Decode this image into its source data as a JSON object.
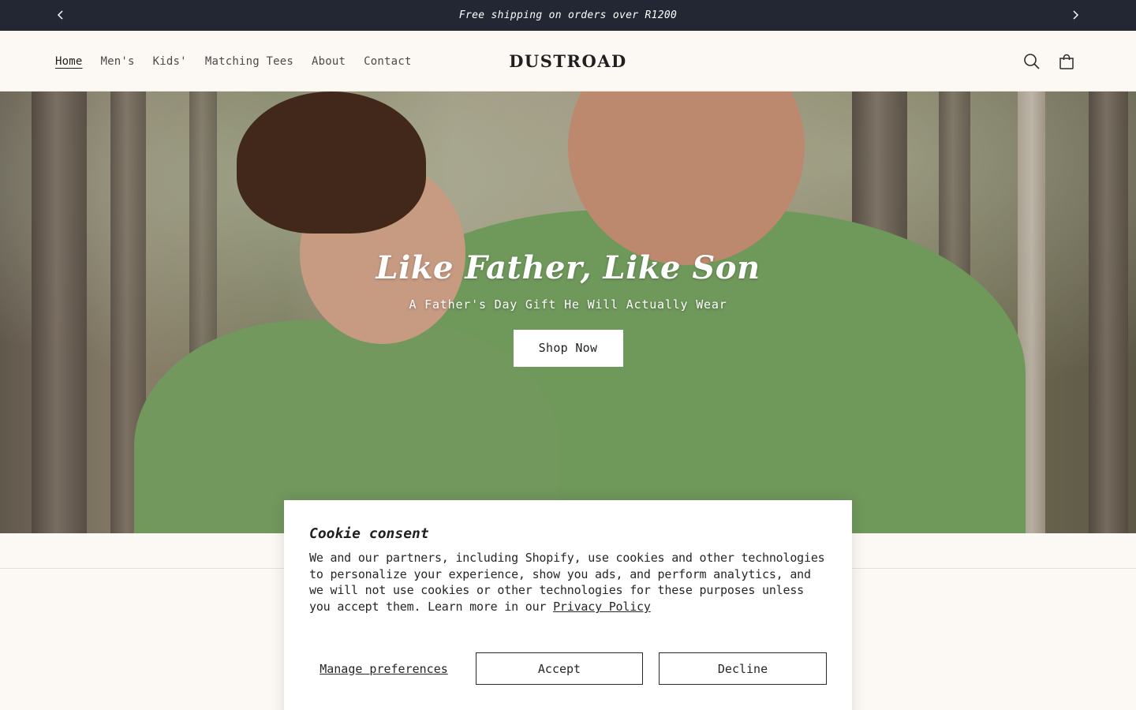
{
  "announcement": {
    "text": "Free shipping on orders over R1200",
    "prev_icon": "chevron-left-icon",
    "next_icon": "chevron-right-icon"
  },
  "header": {
    "nav": [
      {
        "label": "Home",
        "active": true
      },
      {
        "label": "Men's"
      },
      {
        "label": "Kids'"
      },
      {
        "label": "Matching Tees"
      },
      {
        "label": "About"
      },
      {
        "label": "Contact"
      }
    ],
    "logo": "DUSTROAD",
    "icons": [
      "search-icon",
      "cart-icon"
    ]
  },
  "hero": {
    "title": "Like Father, Like Son",
    "subtitle": "A Father's Day Gift He Will Actually Wear",
    "button_label": "Shop Now"
  },
  "cookie": {
    "title": "Cookie consent",
    "body": "We and our partners, including Shopify, use cookies and other technologies to personalize your experience, show you ads, and perform analytics, and we will not use cookies or other technologies for these purposes unless you accept them. Learn more in our ",
    "privacy_link": "Privacy Policy",
    "manage_label": "Manage preferences",
    "accept_label": "Accept",
    "decline_label": "Decline"
  },
  "colors": {
    "announcement_bg": "#232733",
    "page_bg": "#fcf8f4",
    "shirt_green": "#7aa864"
  }
}
